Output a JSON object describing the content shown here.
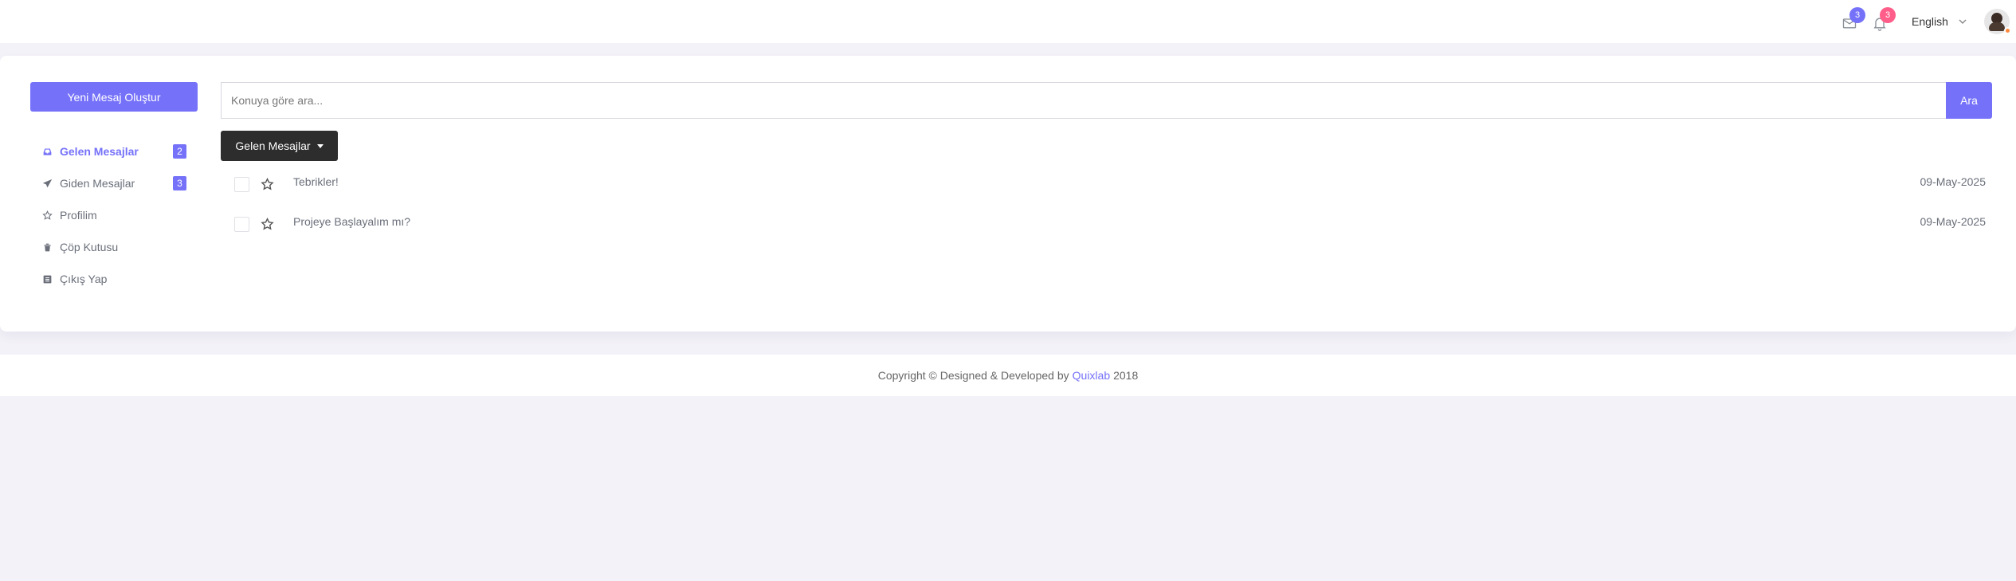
{
  "header": {
    "mail_badge": "3",
    "notification_badge": "3",
    "language": "English"
  },
  "sidebar": {
    "compose_label": "Yeni Mesaj Oluştur",
    "items": [
      {
        "label": "Gelen Mesajlar",
        "count": "2",
        "icon": "inbox-icon",
        "active": true
      },
      {
        "label": "Giden Mesajlar",
        "count": "3",
        "icon": "paper-plane-icon"
      },
      {
        "label": "Profilim",
        "icon": "star-icon"
      },
      {
        "label": "Çöp Kutusu",
        "icon": "trash-icon"
      },
      {
        "label": "Çıkış Yap",
        "icon": "logout-icon"
      }
    ]
  },
  "search": {
    "placeholder": "Konuya göre ara...",
    "button_label": "Ara"
  },
  "folder_dropdown": {
    "selected": "Gelen Mesajlar"
  },
  "messages": [
    {
      "subject": "Tebrikler!",
      "date": "09-May-2025"
    },
    {
      "subject": "Projeye Başlayalım mı?",
      "date": "09-May-2025"
    }
  ],
  "footer": {
    "prefix": "Copyright © Designed & Developed by",
    "link": "Quixlab",
    "year": "2018"
  },
  "colors": {
    "accent": "#7571f9",
    "notification": "#ff5e8a",
    "dark_button": "#2d2d2d",
    "page_bg": "#f3f2f8"
  }
}
